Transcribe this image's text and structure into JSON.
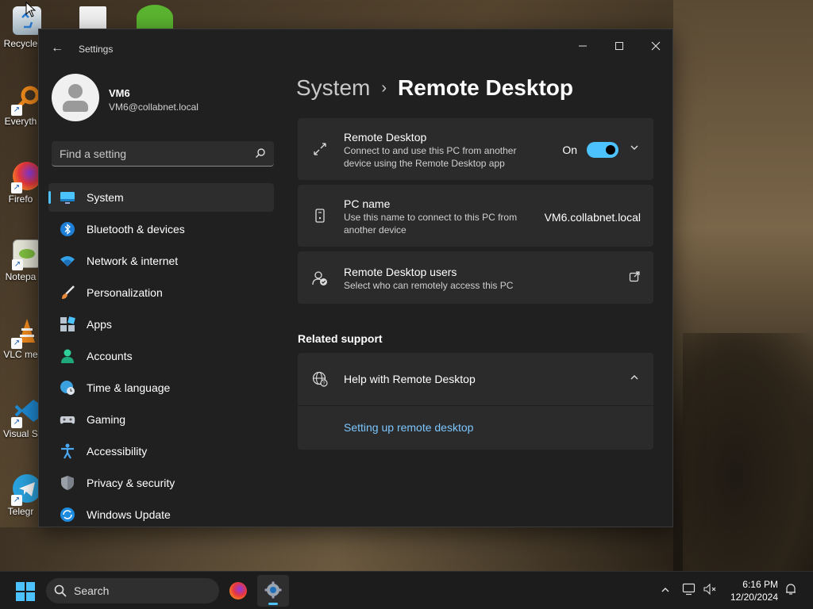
{
  "desktop": {
    "icons": [
      {
        "label": "Recycle Bin",
        "short": "Recycle"
      },
      {
        "label": "Everything",
        "short": "Everyth"
      },
      {
        "label": "Firefox",
        "short": "Firefo"
      },
      {
        "label": "Notepad++",
        "short": "Notepa"
      },
      {
        "label": "VLC media player",
        "short": "VLC me"
      },
      {
        "label": "Visual Studio Code",
        "short": "Visual St"
      },
      {
        "label": "Telegram",
        "short": "Telegr"
      }
    ]
  },
  "window": {
    "title": "Settings",
    "back_icon": "back-arrow-icon",
    "minimize_icon": "minimize-icon",
    "maximize_icon": "maximize-icon",
    "close_icon": "close-icon"
  },
  "profile": {
    "name": "VM6",
    "email": "VM6@collabnet.local"
  },
  "search": {
    "placeholder": "Find a setting"
  },
  "nav": {
    "items": [
      {
        "label": "System",
        "icon": "display-icon",
        "active": true
      },
      {
        "label": "Bluetooth & devices",
        "icon": "bluetooth-icon"
      },
      {
        "label": "Network & internet",
        "icon": "wifi-icon"
      },
      {
        "label": "Personalization",
        "icon": "brush-icon"
      },
      {
        "label": "Apps",
        "icon": "apps-icon"
      },
      {
        "label": "Accounts",
        "icon": "person-icon"
      },
      {
        "label": "Time & language",
        "icon": "globe-clock-icon"
      },
      {
        "label": "Gaming",
        "icon": "controller-icon"
      },
      {
        "label": "Accessibility",
        "icon": "accessibility-icon"
      },
      {
        "label": "Privacy & security",
        "icon": "shield-icon"
      },
      {
        "label": "Windows Update",
        "icon": "update-icon"
      }
    ]
  },
  "breadcrumb": {
    "parent": "System",
    "separator": "›",
    "current": "Remote Desktop"
  },
  "cards": {
    "remote_desktop": {
      "title": "Remote Desktop",
      "subtitle": "Connect to and use this PC from another device using the Remote Desktop app",
      "toggle_label": "On",
      "toggle_on": true
    },
    "pc_name": {
      "title": "PC name",
      "subtitle": "Use this name to connect to this PC from another device",
      "value": "VM6.collabnet.local"
    },
    "users": {
      "title": "Remote Desktop users",
      "subtitle": "Select who can remotely access this PC"
    }
  },
  "related": {
    "heading": "Related support",
    "help_title": "Help with Remote Desktop",
    "link": "Setting up remote desktop"
  },
  "taskbar": {
    "search_label": "Search",
    "time": "6:16 PM",
    "date": "12/20/2024"
  },
  "colors": {
    "accent": "#4cc2ff",
    "window_bg": "#202020",
    "card_bg": "#2b2b2b",
    "link": "#7cc6ff"
  }
}
